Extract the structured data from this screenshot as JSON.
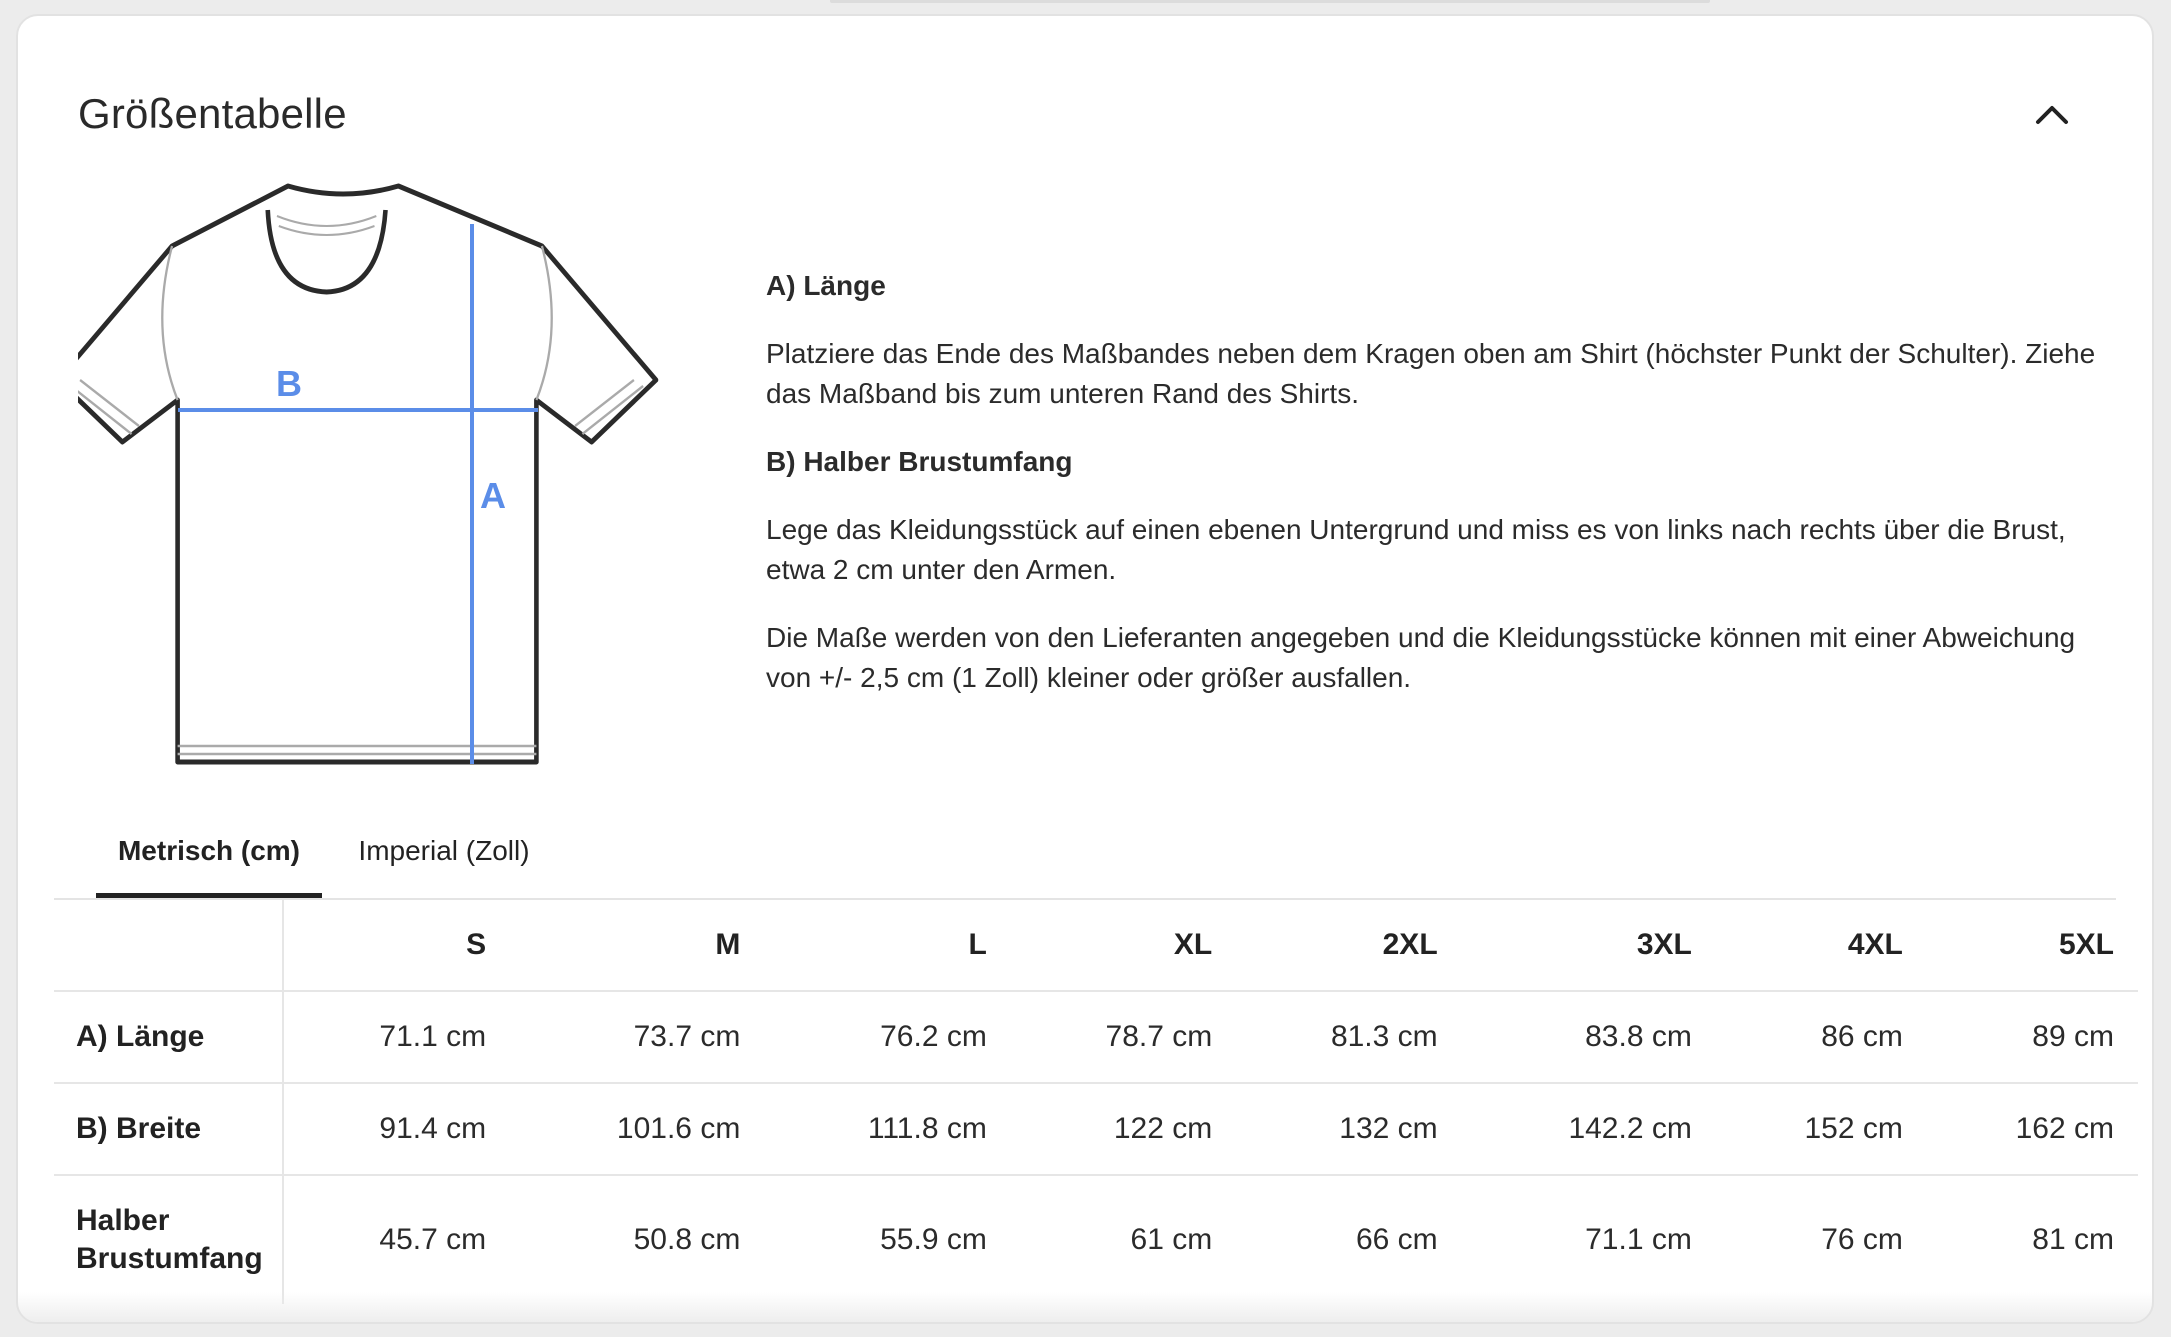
{
  "header": {
    "title": "Größentabelle",
    "collapse_icon": "chevron-up-icon"
  },
  "diagram": {
    "label_a": "A",
    "label_b": "B",
    "accent_color": "#5b8de8"
  },
  "description": {
    "a_heading": "A) Länge",
    "a_text": "Platziere das Ende des Maßbandes neben dem Kragen oben am Shirt (höchster Punkt der Schulter). Ziehe das Maßband bis zum unteren Rand des Shirts.",
    "b_heading": "B) Halber Brustumfang",
    "b_text": "Lege das Kleidungsstück auf einen ebenen Untergrund und miss es von links nach rechts über die Brust, etwa 2 cm unter den Armen.",
    "note": "Die Maße werden von den Lieferanten angegeben und die Kleidungsstücke können mit einer Abweichung von +/- 2,5 cm (1 Zoll) kleiner oder größer ausfallen."
  },
  "tabs": [
    {
      "label": "Metrisch (cm)",
      "active": true
    },
    {
      "label": "Imperial (Zoll)",
      "active": false
    }
  ],
  "table": {
    "sizes": [
      "S",
      "M",
      "L",
      "XL",
      "2XL",
      "3XL",
      "4XL",
      "5XL"
    ],
    "rows": [
      {
        "label": "A) Länge",
        "values": [
          "71.1 cm",
          "73.7 cm",
          "76.2 cm",
          "78.7 cm",
          "81.3 cm",
          "83.8 cm",
          "86 cm",
          "89 cm"
        ]
      },
      {
        "label": "B) Breite",
        "values": [
          "91.4 cm",
          "101.6 cm",
          "111.8 cm",
          "122 cm",
          "132 cm",
          "142.2 cm",
          "152 cm",
          "162 cm"
        ]
      },
      {
        "label": "Halber Brustumfang",
        "values": [
          "45.7 cm",
          "50.8 cm",
          "55.9 cm",
          "61 cm",
          "66 cm",
          "71.1 cm",
          "76 cm",
          "81 cm"
        ]
      }
    ]
  }
}
